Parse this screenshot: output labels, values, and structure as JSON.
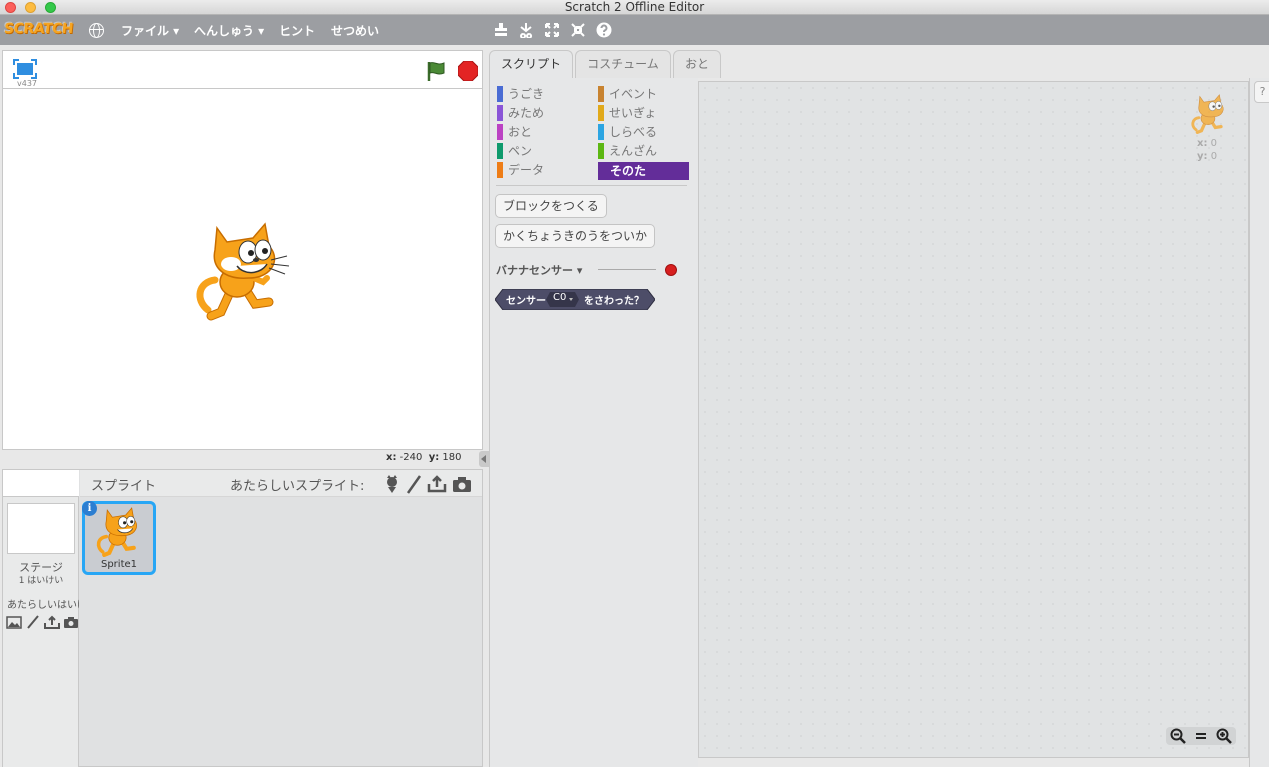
{
  "window": {
    "title": "Scratch 2 Offline Editor"
  },
  "menubar": {
    "logo": "SCRATCH",
    "items": [
      "ファイル ▾",
      "へんしゅう ▾",
      "ヒント",
      "せつめい"
    ]
  },
  "stage": {
    "version": "v437",
    "coords": {
      "x_label": "x:",
      "x_value": "-240",
      "y_label": "y:",
      "y_value": "180"
    }
  },
  "sprites": {
    "title": "スプライト",
    "new_sprite_label": "あたらしいスプライト:",
    "stage_label": "ステージ",
    "stage_sub": "1 はいけい",
    "new_backdrop_label": "あたらしいはいけい:",
    "list": [
      {
        "name": "Sprite1"
      }
    ]
  },
  "tabs": [
    "スクリプト",
    "コスチューム",
    "おと"
  ],
  "palette": {
    "categories_left": [
      {
        "label": "うごき",
        "color": "#4a6cd4"
      },
      {
        "label": "みため",
        "color": "#8a55d7"
      },
      {
        "label": "おと",
        "color": "#bb42c3"
      },
      {
        "label": "ペン",
        "color": "#0e9a6c"
      },
      {
        "label": "データ",
        "color": "#ee7d16"
      }
    ],
    "categories_right": [
      {
        "label": "イベント",
        "color": "#c88330"
      },
      {
        "label": "せいぎょ",
        "color": "#e1a91a"
      },
      {
        "label": "しらべる",
        "color": "#2ca5e2"
      },
      {
        "label": "えんざん",
        "color": "#5cb712"
      },
      {
        "label": "そのた",
        "color": "#632d99",
        "selected": true
      }
    ],
    "make_block_button": "ブロックをつくる",
    "add_extension_button": "かくちょうきのうをついか",
    "extension": {
      "name": "バナナセンサー ▾",
      "status_color": "#d71f1f"
    },
    "sensor_block": {
      "prefix": "センサー",
      "dropdown": "C0",
      "suffix": "をさわった？"
    }
  },
  "script_area": {
    "x_label": "x:",
    "x_value": "0",
    "y_label": "y:",
    "y_value": "0",
    "zoom": [
      "−",
      "=",
      "+"
    ]
  },
  "help_tab": "?"
}
